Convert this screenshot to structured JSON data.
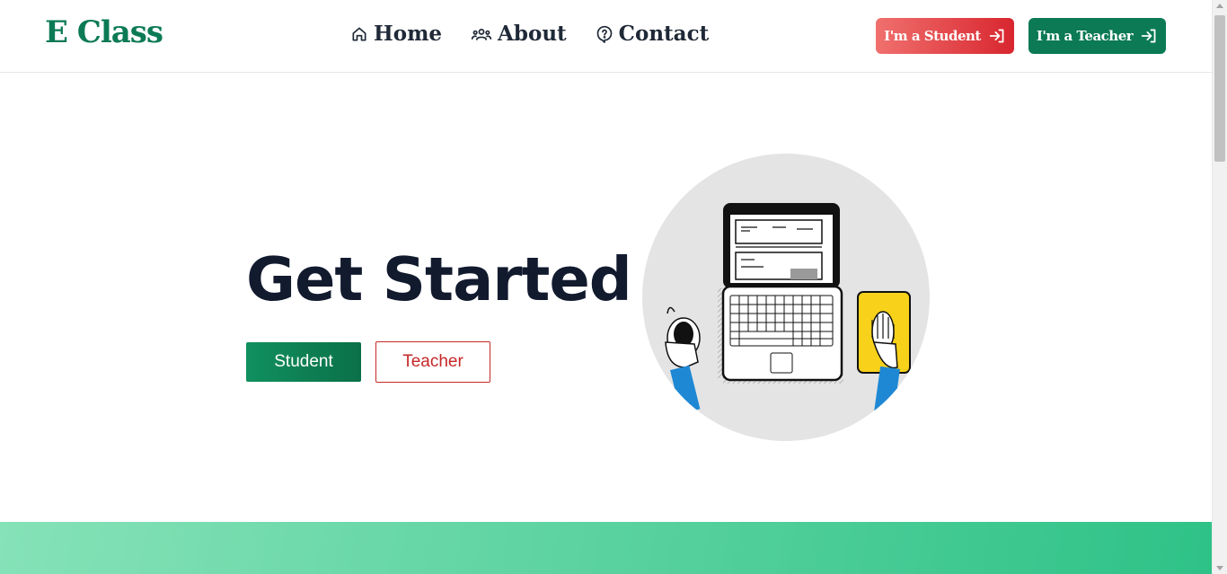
{
  "header": {
    "logo": "E Class",
    "nav": [
      {
        "label": "Home",
        "icon": "home-icon"
      },
      {
        "label": "About",
        "icon": "users-icon"
      },
      {
        "label": "Contact",
        "icon": "help-circle-icon"
      }
    ],
    "student_button": "I'm a Student",
    "teacher_button": "I'm a Teacher"
  },
  "hero": {
    "title": "Get Started",
    "student_button": "Student",
    "teacher_button": "Teacher"
  },
  "colors": {
    "brand_green": "#0b7a55",
    "student_red": "#d8262f",
    "title_dark": "#121a2e",
    "band_start": "#86e2b8",
    "band_end": "#2ec287"
  }
}
